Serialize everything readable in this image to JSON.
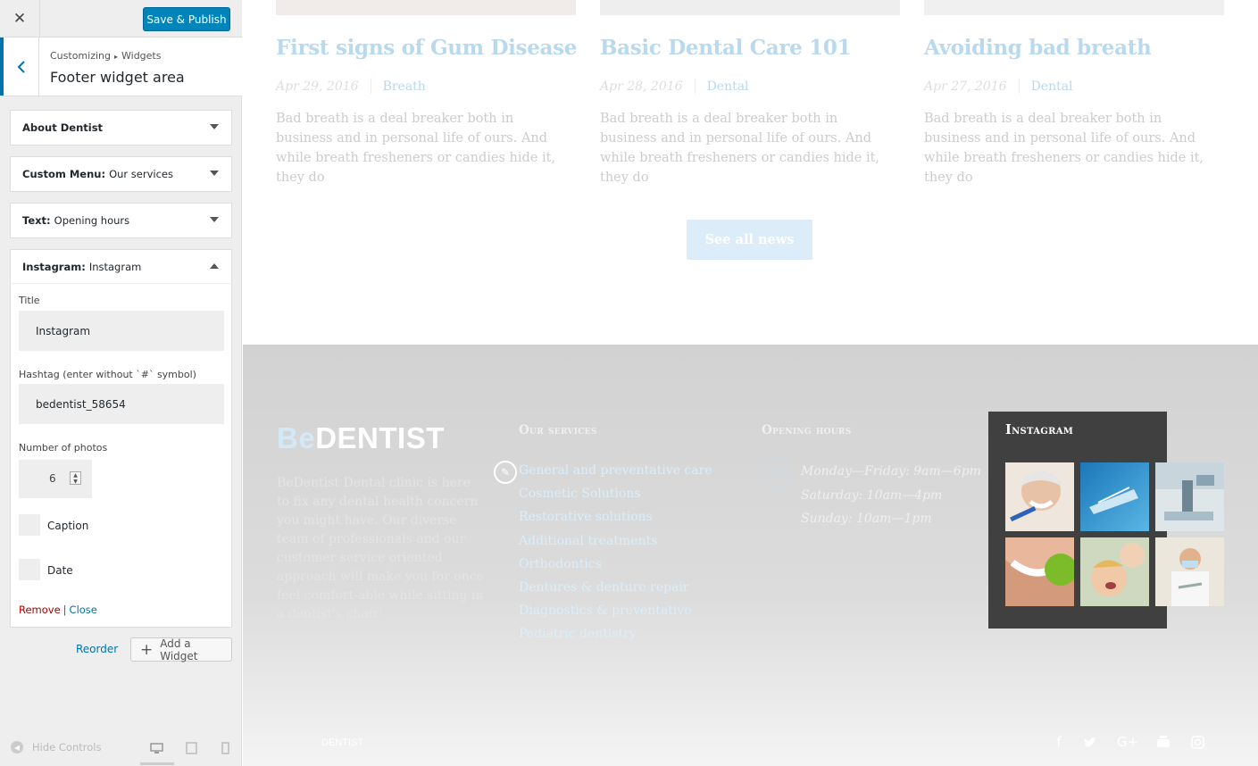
{
  "sidebar": {
    "close_symbol": "✕",
    "publish_label": "Save & Publish",
    "breadcrumb": {
      "parent": "Customizing",
      "separator": "▸",
      "current": "Widgets"
    },
    "panel_title": "Footer widget area",
    "widgets": [
      {
        "type": "About Dentist",
        "name": ""
      },
      {
        "type": "Custom Menu:",
        "name": "Our services"
      },
      {
        "type": "Text:",
        "name": "Opening hours"
      },
      {
        "type": "Instagram:",
        "name": "Instagram"
      }
    ],
    "form": {
      "title_label": "Title",
      "title_value": "Instagram",
      "hashtag_label": "Hashtag (enter without `#` symbol)",
      "hashtag_value": "bedentist_58654",
      "photos_label": "Number of photos",
      "photos_value": "6",
      "caption_label": "Caption",
      "date_label": "Date",
      "remove_label": "Remove",
      "link_separator": "|",
      "close_label": "Close"
    },
    "reorder_label": "Reorder",
    "add_widget_label": "Add a Widget",
    "hide_controls_label": "Hide Controls"
  },
  "preview": {
    "posts": [
      {
        "title": "First signs of Gum Disease",
        "date": "Apr 29, 2016",
        "category": "Breath",
        "excerpt": "Bad breath is a deal breaker both in business and in personal life of ours. And while breath fresheners or candies hide it, they do"
      },
      {
        "title": "Basic Dental Care 101",
        "date": "Apr 28, 2016",
        "category": "Dental",
        "excerpt": "Bad breath is a deal breaker both in business and in personal life of ours. And while breath fresheners or candies hide it, they do"
      },
      {
        "title": "Avoiding bad breath",
        "date": "Apr 27, 2016",
        "category": "Dental",
        "excerpt": "Bad breath is a deal breaker both in business and in personal life of ours. And while breath fresheners or candies hide it, they do"
      }
    ],
    "see_all_label": "See all news",
    "footer": {
      "logo_prefix": "Be",
      "logo_suffix": "DENTIST",
      "about_text": "BeDentist Dental clinic is here to fix any dental health concern you might have. Our diverse team of professionals and our customer service oriented approach will make you for once feel comfort-able while sitting in a dentist's chair!",
      "services_heading": "Our services",
      "services": [
        "General and preventative care",
        "Cosmetic Solutions",
        "Restorative solutions",
        "Additional treatments",
        "Orthodontics",
        "Dentures & denture repair",
        "Diagnostics & preventative",
        "Pediatric dentistry"
      ],
      "hours_heading": "Opening hours",
      "hours": [
        "Monday—Friday: 9am—6pm",
        "Saturday: 10am—4pm",
        "Sunday: 10am—1pm"
      ],
      "instagram_heading": "Instagram",
      "bottom_logo": "DENTIST"
    }
  },
  "colors": {
    "accent": "#0085ba",
    "link": "#0073aa",
    "remove": "#aa0000",
    "instagram_bg": "#404040",
    "footer_bg": "#d2d2d2"
  }
}
